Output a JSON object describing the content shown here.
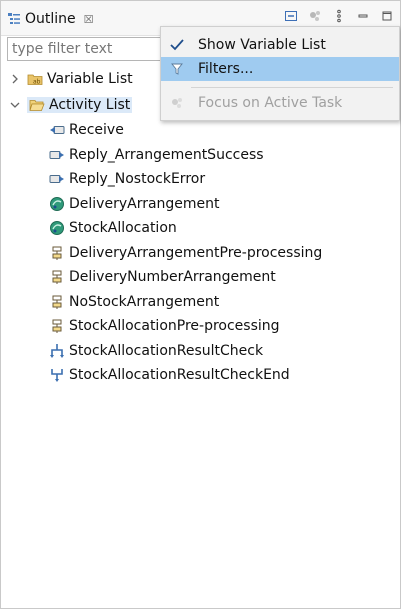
{
  "view": {
    "title": "Outline",
    "close_glyph": "☒",
    "icon": "outline-icon"
  },
  "filter": {
    "placeholder": "type filter text"
  },
  "tree": {
    "variable_list": "Variable List",
    "activity_list": "Activity List",
    "activities": [
      {
        "label": "Receive",
        "icon": "receive-icon"
      },
      {
        "label": "Reply_ArrangementSuccess",
        "icon": "reply-icon"
      },
      {
        "label": "Reply_NostockError",
        "icon": "reply-icon"
      },
      {
        "label": "DeliveryArrangement",
        "icon": "invoke-icon"
      },
      {
        "label": "StockAllocation",
        "icon": "invoke-icon"
      },
      {
        "label": "DeliveryArrangementPre-processing",
        "icon": "assign-icon"
      },
      {
        "label": "DeliveryNumberArrangement",
        "icon": "assign-icon"
      },
      {
        "label": "NoStockArrangement",
        "icon": "assign-icon"
      },
      {
        "label": "StockAllocationPre-processing",
        "icon": "assign-icon"
      },
      {
        "label": "StockAllocationResultCheck",
        "icon": "switch-icon"
      },
      {
        "label": "StockAllocationResultCheckEnd",
        "icon": "merge-icon"
      }
    ]
  },
  "menu": {
    "items": [
      {
        "label": "Show Variable List",
        "checked": true
      },
      {
        "label": "Filters...",
        "highlighted": true
      },
      {
        "label": "Focus on Active Task",
        "disabled": true
      }
    ]
  },
  "colors": {
    "selection": "#dbe9f8",
    "menu_highlight": "#9fcbf0",
    "check": "#1f4e8c"
  }
}
